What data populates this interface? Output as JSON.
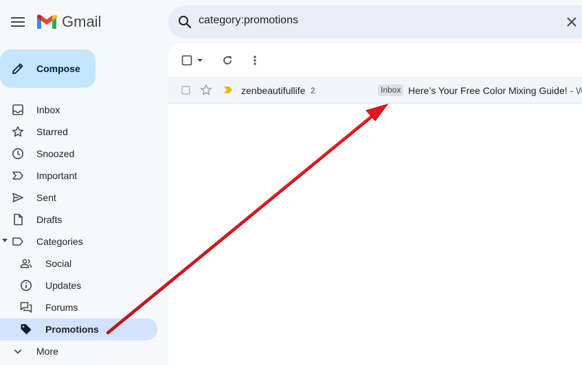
{
  "app": {
    "title": "Gmail"
  },
  "search": {
    "query": "category:promotions"
  },
  "compose": {
    "label": "Compose"
  },
  "nav": {
    "inbox": "Inbox",
    "starred": "Starred",
    "snoozed": "Snoozed",
    "important": "Important",
    "sent": "Sent",
    "drafts": "Drafts",
    "categories": "Categories",
    "social": "Social",
    "updates": "Updates",
    "forums": "Forums",
    "promotions": "Promotions",
    "more": "More"
  },
  "email": {
    "sender": "zenbeautifullife",
    "count": "2",
    "label": "Inbox",
    "subject": "Here’s Your Free Color Mixing Guide!",
    "snippet": " - W"
  },
  "colors": {
    "compose_bg": "#c2e7ff",
    "active_nav_bg": "#d3e3fd",
    "important_marker": "#f2b312",
    "annotation_arrow": "#e8141b"
  }
}
